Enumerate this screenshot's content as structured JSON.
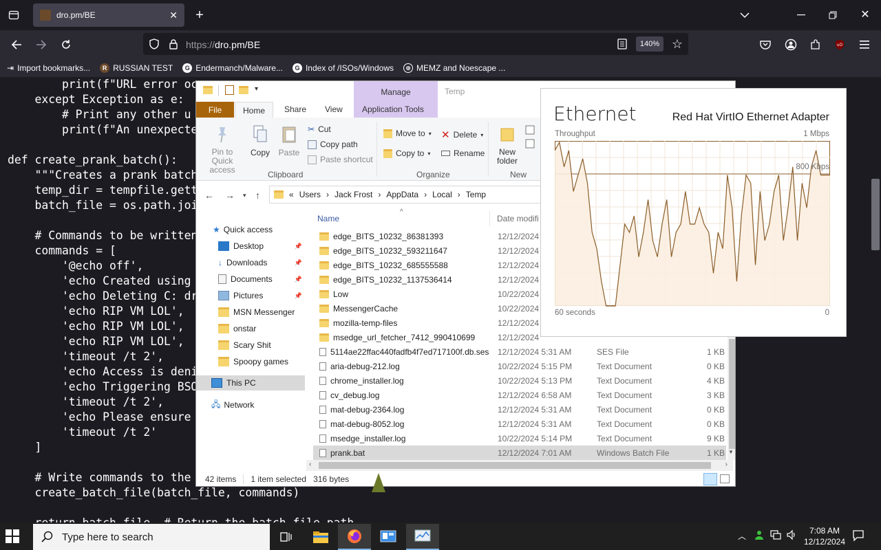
{
  "browser": {
    "tab_title": "dro.pm/BE",
    "url_prefix": "https://",
    "url_host": "dro.pm/BE",
    "zoom": "140%",
    "bookmarks": [
      "Import bookmarks...",
      "RUSSIAN TEST",
      "Endermanch/Malware...",
      "Index of /ISOs/Windows",
      "MEMZ and Noescape ..."
    ]
  },
  "code_lines": [
    "        print(f\"URL error oc",
    "    except Exception as e:",
    "        # Print any other u",
    "        print(f\"An unexpecte",
    "",
    "def create_prank_batch():",
    "    \"\"\"Creates a prank batch",
    "    temp_dir = tempfile.gett",
    "    batch_file = os.path.joi",
    "",
    "    # Commands to be written",
    "    commands = [",
    "        '@echo off',",
    "        'echo Created using",
    "        'echo Deleting C: dr",
    "        'echo RIP VM LOL',",
    "        'echo RIP VM LOL',",
    "        'echo RIP VM LOL',",
    "        'timeout /t 2',",
    "        'echo Access is deni",
    "        'echo Triggering BSO",
    "        'timeout /t 2',",
    "        'echo Please ensure",
    "        'timeout /t 2'",
    "    ]",
    "",
    "    # Write commands to the",
    "    create_batch_file(batch_file, commands)",
    "",
    "    return batch_file  # Return the batch file path"
  ],
  "explorer": {
    "context_tab": "Manage",
    "title": "Temp",
    "tabs": {
      "file": "File",
      "home": "Home",
      "share": "Share",
      "view": "View",
      "app_tools": "Application Tools"
    },
    "ribbon": {
      "pin": "Pin to Quick access",
      "copy": "Copy",
      "paste": "Paste",
      "cut": "Cut",
      "copy_path": "Copy path",
      "paste_shortcut": "Paste shortcut",
      "clipboard": "Clipboard",
      "move_to": "Move to",
      "copy_to": "Copy to",
      "delete": "Delete",
      "rename": "Rename",
      "organize": "Organize",
      "new_folder": "New folder",
      "new": "New"
    },
    "breadcrumb": [
      "Users",
      "Jack Frost",
      "AppData",
      "Local",
      "Temp"
    ],
    "nav": [
      {
        "label": "Quick access",
        "pinned": false
      },
      {
        "label": "Desktop",
        "pinned": true
      },
      {
        "label": "Downloads",
        "pinned": true
      },
      {
        "label": "Documents",
        "pinned": true
      },
      {
        "label": "Pictures",
        "pinned": true
      },
      {
        "label": "MSN Messenger",
        "pinned": false
      },
      {
        "label": "onstar",
        "pinned": false
      },
      {
        "label": "Scary Shit",
        "pinned": false
      },
      {
        "label": "Spoopy games",
        "pinned": false
      },
      {
        "label": "This PC",
        "pinned": false
      },
      {
        "label": "Network",
        "pinned": false
      }
    ],
    "columns": {
      "name": "Name",
      "date": "Date modifi"
    },
    "files": [
      {
        "name": "edge_BITS_10232_86381393",
        "date": "12/12/2024",
        "type": "",
        "size": "",
        "kind": "folder"
      },
      {
        "name": "edge_BITS_10232_593211647",
        "date": "12/12/2024",
        "type": "",
        "size": "",
        "kind": "folder"
      },
      {
        "name": "edge_BITS_10232_685555588",
        "date": "12/12/2024",
        "type": "",
        "size": "",
        "kind": "folder"
      },
      {
        "name": "edge_BITS_10232_1137536414",
        "date": "12/12/2024",
        "type": "",
        "size": "",
        "kind": "folder"
      },
      {
        "name": "Low",
        "date": "10/22/2024",
        "type": "",
        "size": "",
        "kind": "folder"
      },
      {
        "name": "MessengerCache",
        "date": "10/22/2024",
        "type": "",
        "size": "",
        "kind": "folder"
      },
      {
        "name": "mozilla-temp-files",
        "date": "12/12/2024",
        "type": "",
        "size": "",
        "kind": "folder"
      },
      {
        "name": "msedge_url_fetcher_7412_990410699",
        "date": "12/12/2024",
        "type": "",
        "size": "",
        "kind": "folder"
      },
      {
        "name": "5114ae22ffac440fadfb4f7ed717100f.db.ses",
        "date": "12/12/2024 5:31 AM",
        "type": "SES File",
        "size": "1 KB",
        "kind": "doc"
      },
      {
        "name": "aria-debug-212.log",
        "date": "10/22/2024 5:15 PM",
        "type": "Text Document",
        "size": "0 KB",
        "kind": "doc"
      },
      {
        "name": "chrome_installer.log",
        "date": "10/22/2024 5:13 PM",
        "type": "Text Document",
        "size": "4 KB",
        "kind": "doc"
      },
      {
        "name": "cv_debug.log",
        "date": "12/12/2024 6:58 AM",
        "type": "Text Document",
        "size": "3 KB",
        "kind": "doc"
      },
      {
        "name": "mat-debug-2364.log",
        "date": "12/12/2024 5:31 AM",
        "type": "Text Document",
        "size": "0 KB",
        "kind": "doc"
      },
      {
        "name": "mat-debug-8052.log",
        "date": "12/12/2024 5:31 AM",
        "type": "Text Document",
        "size": "0 KB",
        "kind": "doc"
      },
      {
        "name": "msedge_installer.log",
        "date": "10/22/2024 5:14 PM",
        "type": "Text Document",
        "size": "9 KB",
        "kind": "doc"
      },
      {
        "name": "prank.bat",
        "date": "12/12/2024 7:01 AM",
        "type": "Windows Batch File",
        "size": "1 KB",
        "kind": "bat"
      }
    ],
    "status": {
      "items": "42 items",
      "selected": "1 item selected",
      "bytes": "316 bytes"
    }
  },
  "ethernet": {
    "title": "Ethernet",
    "adapter": "Red Hat VirtIO Ethernet Adapter",
    "throughput_label": "Throughput",
    "max_label": "1 Mbps",
    "mid_label": "800 Kbps",
    "time_label": "60 seconds",
    "zero_label": "0",
    "series": [
      0.95,
      1.0,
      0.85,
      0.95,
      0.7,
      0.8,
      0.9,
      0.75,
      0.45,
      0.35,
      0.15,
      0.0,
      0.0,
      0.0,
      0.25,
      0.5,
      0.45,
      0.55,
      0.3,
      0.45,
      0.65,
      0.4,
      0.3,
      0.5,
      0.65,
      0.3,
      0.45,
      0.5,
      0.7,
      0.5,
      0.5,
      0.6,
      0.5,
      0.45,
      0.2,
      0.45,
      0.35,
      0.8,
      0.6,
      0.15,
      0.55,
      0.8,
      0.75,
      0.25,
      0.7,
      0.4,
      0.5,
      0.7,
      0.8,
      0.4,
      0.6,
      0.85,
      0.4,
      0.75,
      0.6,
      0.85,
      0.95,
      0.8,
      0.8,
      0.8
    ],
    "accent": "#8b5e2b",
    "fill": "#fbeee0"
  },
  "taskbar": {
    "search_placeholder": "Type here to search",
    "time": "7:08 AM",
    "date": "12/12/2024"
  }
}
